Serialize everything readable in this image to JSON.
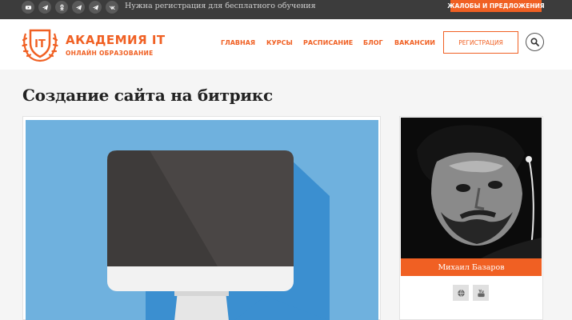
{
  "topbar": {
    "social_icons": [
      "youtube-icon",
      "telegram-icon",
      "odnoklassniki-icon",
      "telegram-icon",
      "telegram-icon",
      "vk-icon"
    ],
    "registration_note": "Нужна регистрация для бесплатного обучения",
    "complaints_label": "ЖАЛОБЫ И ПРЕДЛОЖЕНИЯ"
  },
  "header": {
    "logo_title": "АКАДЕМИЯ IT",
    "logo_subtitle": "ОНЛАЙН ОБРАЗОВАНИЕ",
    "logo_mark_text": "IT",
    "nav": [
      "ГЛАВНАЯ",
      "КУРСЫ",
      "РАСПИСАНИЕ",
      "БЛОГ",
      "ВАКАНСИИ"
    ],
    "register_label": "РЕГИСТРАЦИЯ",
    "search_icon": "search-icon"
  },
  "page": {
    "title": "Создание сайта на битрикс"
  },
  "author": {
    "name": "Михаил Базаров",
    "links": [
      "globe-icon",
      "youtube-icon"
    ]
  },
  "colors": {
    "accent": "#f06023",
    "topbar": "#3c3c3c",
    "image_bg": "#6fb1de"
  }
}
